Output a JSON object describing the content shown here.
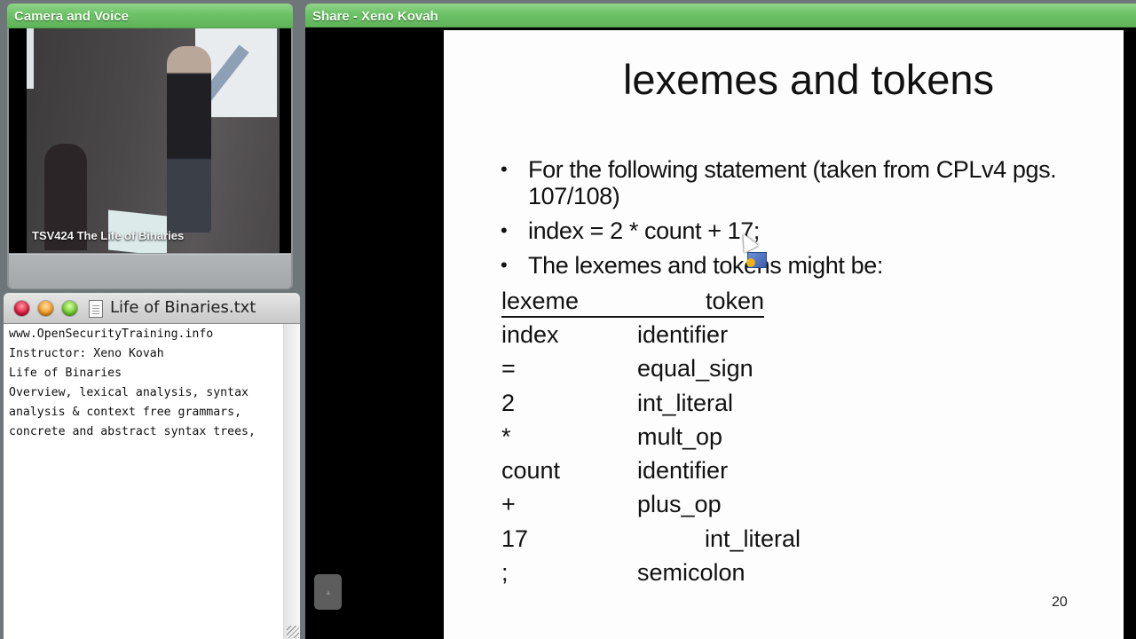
{
  "camera_pod": {
    "title": "Camera and Voice",
    "video_caption": "TSV424 The Life of Binaries"
  },
  "notes_window": {
    "title": "Life of Binaries.txt",
    "lines": [
      "www.OpenSecurityTraining.info",
      "Instructor: Xeno Kovah",
      "Life of Binaries",
      "Overview, lexical analysis, syntax",
      "analysis & context free grammars,",
      "concrete and abstract syntax trees,"
    ]
  },
  "share_pod": {
    "title": "Share - Xeno Kovah"
  },
  "slide": {
    "title": "lexemes and tokens",
    "bullets": [
      "For the following statement (taken from CPLv4 pgs. 107/108)",
      "index =  2 * count + 17;",
      "The lexemes and tokens might be:"
    ],
    "table_headers": {
      "lexeme": "lexeme",
      "token": "token"
    },
    "rows": [
      {
        "lexeme": "index",
        "token": "identifier"
      },
      {
        "lexeme": "=",
        "token": "equal_sign"
      },
      {
        "lexeme": "2",
        "token": "int_literal"
      },
      {
        "lexeme": "*",
        "token": "mult_op"
      },
      {
        "lexeme": "count",
        "token": "identifier"
      },
      {
        "lexeme": "+",
        "token": "plus_op"
      },
      {
        "lexeme": "17",
        "token": "int_literal"
      },
      {
        "lexeme": ";",
        "token": "semicolon"
      }
    ],
    "page_number": "20"
  },
  "colors": {
    "pod_title_green": "#6cc266",
    "slide_background": "#fdfdfd",
    "share_background": "#000000"
  }
}
